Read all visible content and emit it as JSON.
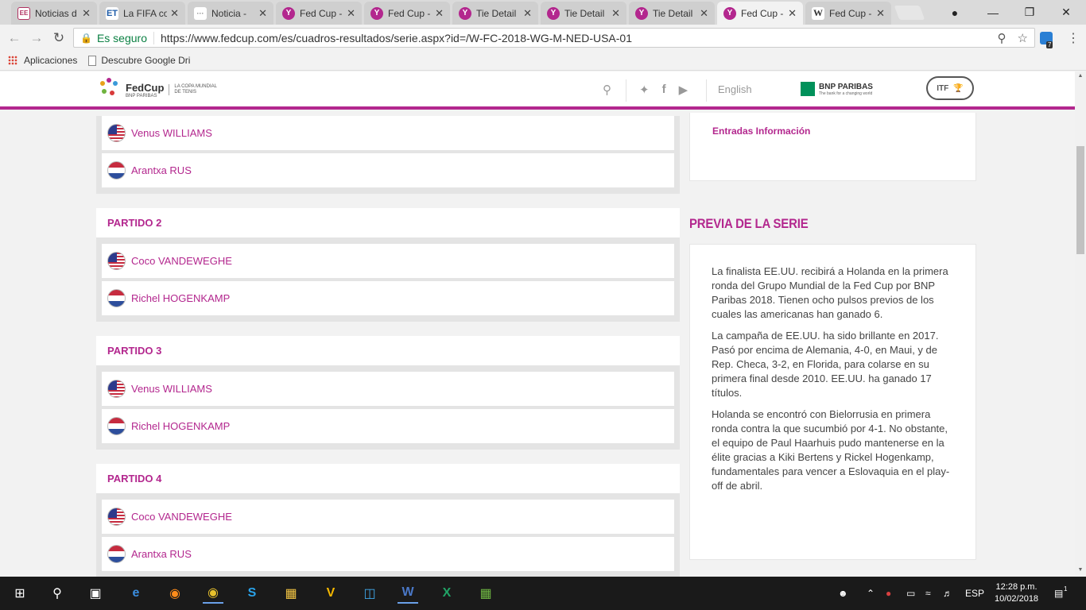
{
  "browser": {
    "tabs": [
      {
        "label": "Noticias d",
        "favicon": "EE",
        "icon": "ee"
      },
      {
        "label": "La FIFA co",
        "favicon": "ET",
        "icon": "et"
      },
      {
        "label": "Noticia -",
        "favicon": "···",
        "icon": "dots"
      },
      {
        "label": "Fed Cup -",
        "favicon": "Y",
        "icon": "fc"
      },
      {
        "label": "Fed Cup -",
        "favicon": "Y",
        "icon": "fc"
      },
      {
        "label": "Tie Detail",
        "favicon": "Y",
        "icon": "fc"
      },
      {
        "label": "Tie Detail",
        "favicon": "Y",
        "icon": "fc"
      },
      {
        "label": "Tie Detail",
        "favicon": "Y",
        "icon": "fc"
      },
      {
        "label": "Fed Cup -",
        "favicon": "Y",
        "icon": "fc",
        "active": true
      },
      {
        "label": "Fed Cup -",
        "favicon": "W",
        "icon": "w"
      }
    ],
    "secure_label": "Es seguro",
    "url": "https://www.fedcup.com/es/cuadros-resultados/serie.aspx?id=/W-FC-2018-WG-M-NED-USA-01",
    "extension_badge": "7",
    "bookmarks": {
      "apps": "Aplicaciones",
      "item1": "Descubre Google Dri"
    }
  },
  "site": {
    "logo_name": "FedCup",
    "logo_sponsor": "BNP PARIBAS",
    "logo_tagline_1": "LA COPA MUNDIAL",
    "logo_tagline_2": "DE TENIS",
    "language_link": "English",
    "sponsor_name": "BNP PARIBAS",
    "sponsor_tagline": "The bank for a changing world",
    "itf_logo": "ITF"
  },
  "matches": {
    "partial": {
      "players": [
        {
          "name": "Venus WILLIAMS",
          "country": "usa"
        },
        {
          "name": "Arantxa RUS",
          "country": "ned"
        }
      ]
    },
    "list": [
      {
        "title": "PARTIDO 2",
        "players": [
          {
            "name": "Coco VANDEWEGHE",
            "country": "usa"
          },
          {
            "name": "Richel HOGENKAMP",
            "country": "ned"
          }
        ]
      },
      {
        "title": "PARTIDO 3",
        "players": [
          {
            "name": "Venus WILLIAMS",
            "country": "usa"
          },
          {
            "name": "Richel HOGENKAMP",
            "country": "ned"
          }
        ]
      },
      {
        "title": "PARTIDO 4",
        "players": [
          {
            "name": "Coco VANDEWEGHE",
            "country": "usa"
          },
          {
            "name": "Arantxa RUS",
            "country": "ned"
          }
        ]
      }
    ]
  },
  "sidebar": {
    "entries_link": "Entradas Información",
    "preview_title": "PREVIA DE LA SERIE",
    "preview_paragraphs": [
      "La finalista EE.UU. recibirá a Holanda en la primera ronda del Grupo Mundial de la Fed Cup por BNP Paribas 2018. Tienen ocho pulsos previos de los cuales las americanas han ganado 6.",
      "La campaña de EE.UU. ha sido brillante en 2017. Pasó por encima de Alemania, 4-0, en Maui, y de Rep. Checa, 3-2, en Florida, para colarse en su primera final desde 2010. EE.UU. ha ganado 17 títulos.",
      "Holanda se encontró con Bielorrusia en primera ronda contra la que sucumbió por 4-1. No obstante, el equipo de Paul Haarhuis pudo mantenerse en la élite gracias a Kiki Bertens y Rickel Hogenkamp, fundamentales para vencer a Eslovaquia en el play-off de abril."
    ]
  },
  "taskbar": {
    "language": "ESP",
    "time": "12:28 p.m.",
    "date": "10/02/2018",
    "notification_count": "1"
  },
  "colors": {
    "accent": "#b3278e",
    "secure": "#0b8043"
  }
}
